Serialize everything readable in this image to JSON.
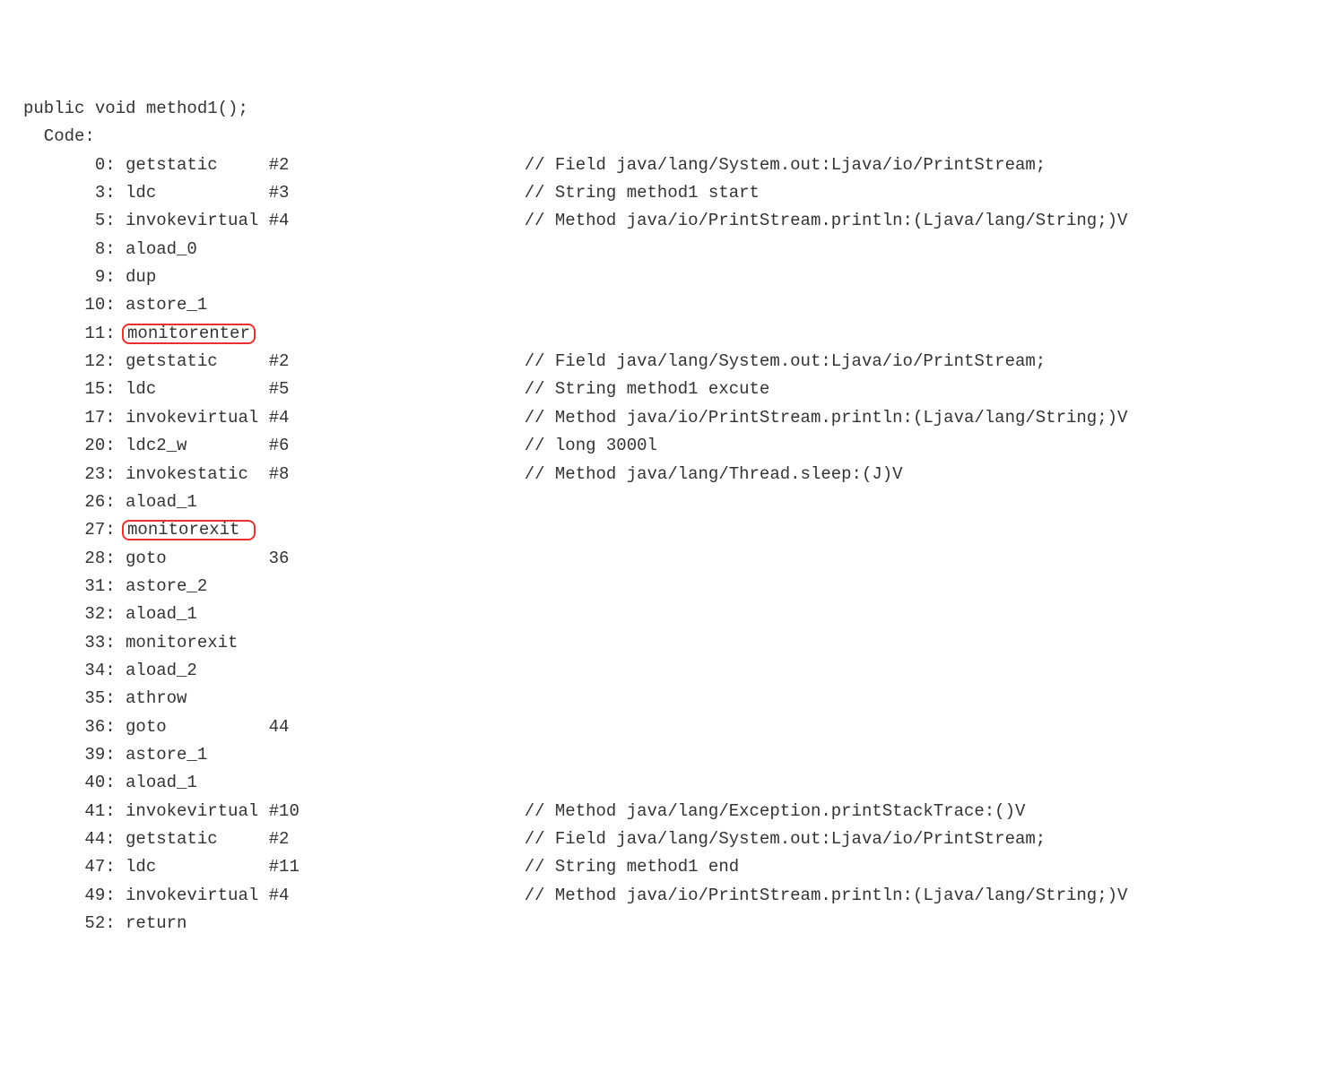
{
  "header": {
    "signature": "public void method1();",
    "code_label": "Code:"
  },
  "instructions": [
    {
      "offset": "0",
      "opcode": "getstatic",
      "arg": "#2",
      "comment": "// Field java/lang/System.out:Ljava/io/PrintStream;",
      "highlight": false
    },
    {
      "offset": "3",
      "opcode": "ldc",
      "arg": "#3",
      "comment": "// String method1 start",
      "highlight": false
    },
    {
      "offset": "5",
      "opcode": "invokevirtual",
      "arg": "#4",
      "comment": "// Method java/io/PrintStream.println:(Ljava/lang/String;)V",
      "highlight": false
    },
    {
      "offset": "8",
      "opcode": "aload_0",
      "arg": "",
      "comment": "",
      "highlight": false
    },
    {
      "offset": "9",
      "opcode": "dup",
      "arg": "",
      "comment": "",
      "highlight": false
    },
    {
      "offset": "10",
      "opcode": "astore_1",
      "arg": "",
      "comment": "",
      "highlight": false
    },
    {
      "offset": "11",
      "opcode": "monitorenter",
      "arg": "",
      "comment": "",
      "highlight": true
    },
    {
      "offset": "12",
      "opcode": "getstatic",
      "arg": "#2",
      "comment": "// Field java/lang/System.out:Ljava/io/PrintStream;",
      "highlight": false
    },
    {
      "offset": "15",
      "opcode": "ldc",
      "arg": "#5",
      "comment": "// String method1 excute",
      "highlight": false
    },
    {
      "offset": "17",
      "opcode": "invokevirtual",
      "arg": "#4",
      "comment": "// Method java/io/PrintStream.println:(Ljava/lang/String;)V",
      "highlight": false
    },
    {
      "offset": "20",
      "opcode": "ldc2_w",
      "arg": "#6",
      "comment": "// long 3000l",
      "highlight": false
    },
    {
      "offset": "23",
      "opcode": "invokestatic",
      "arg": "#8",
      "comment": "// Method java/lang/Thread.sleep:(J)V",
      "highlight": false
    },
    {
      "offset": "26",
      "opcode": "aload_1",
      "arg": "",
      "comment": "",
      "highlight": false
    },
    {
      "offset": "27",
      "opcode": "monitorexit",
      "arg": "",
      "comment": "",
      "highlight": true
    },
    {
      "offset": "28",
      "opcode": "goto",
      "arg": "36",
      "comment": "",
      "highlight": false
    },
    {
      "offset": "31",
      "opcode": "astore_2",
      "arg": "",
      "comment": "",
      "highlight": false
    },
    {
      "offset": "32",
      "opcode": "aload_1",
      "arg": "",
      "comment": "",
      "highlight": false
    },
    {
      "offset": "33",
      "opcode": "monitorexit",
      "arg": "",
      "comment": "",
      "highlight": false
    },
    {
      "offset": "34",
      "opcode": "aload_2",
      "arg": "",
      "comment": "",
      "highlight": false
    },
    {
      "offset": "35",
      "opcode": "athrow",
      "arg": "",
      "comment": "",
      "highlight": false
    },
    {
      "offset": "36",
      "opcode": "goto",
      "arg": "44",
      "comment": "",
      "highlight": false
    },
    {
      "offset": "39",
      "opcode": "astore_1",
      "arg": "",
      "comment": "",
      "highlight": false
    },
    {
      "offset": "40",
      "opcode": "aload_1",
      "arg": "",
      "comment": "",
      "highlight": false
    },
    {
      "offset": "41",
      "opcode": "invokevirtual",
      "arg": "#10",
      "comment": "// Method java/lang/Exception.printStackTrace:()V",
      "highlight": false
    },
    {
      "offset": "44",
      "opcode": "getstatic",
      "arg": "#2",
      "comment": "// Field java/lang/System.out:Ljava/io/PrintStream;",
      "highlight": false
    },
    {
      "offset": "47",
      "opcode": "ldc",
      "arg": "#11",
      "comment": "// String method1 end",
      "highlight": false
    },
    {
      "offset": "49",
      "opcode": "invokevirtual",
      "arg": "#4",
      "comment": "// Method java/io/PrintStream.println:(Ljava/lang/String;)V",
      "highlight": false
    },
    {
      "offset": "52",
      "opcode": "return",
      "arg": "",
      "comment": "",
      "highlight": false
    }
  ]
}
